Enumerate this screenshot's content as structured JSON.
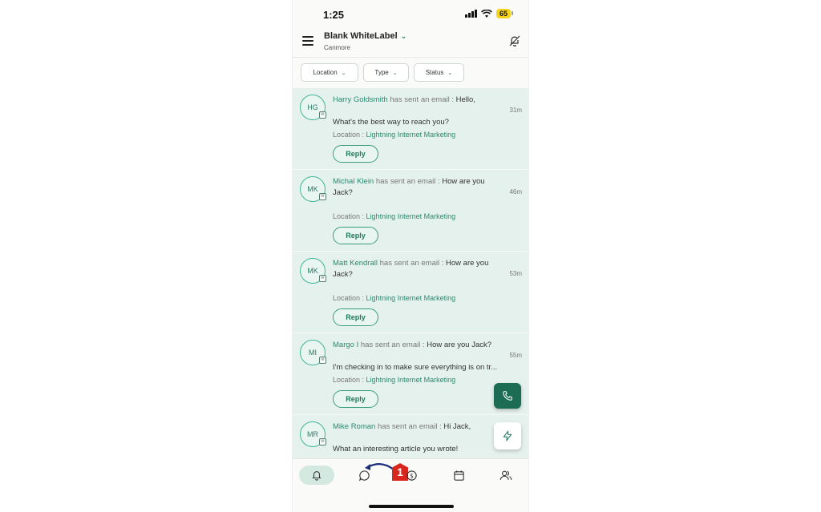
{
  "status_bar": {
    "time": "1:25",
    "battery": "65"
  },
  "header": {
    "title": "Blank WhiteLabel",
    "subtitle": "Canmore"
  },
  "filters": [
    "Location",
    "Type",
    "Status"
  ],
  "conversations": [
    {
      "initials": "HG",
      "name": "Harry Goldsmith",
      "action": "has sent an email :",
      "line1": "Hello,",
      "line2": "What's the best way to reach you?",
      "time": "31m",
      "location_label": "Location :",
      "location": "Lightning Internet Marketing",
      "reply": "Reply"
    },
    {
      "initials": "MK",
      "name": "Michal Klein",
      "action": "has sent an email :",
      "line1": "How are you",
      "line2": "Jack?",
      "time": "46m",
      "location_label": "Location :",
      "location": "Lightning Internet Marketing",
      "reply": "Reply"
    },
    {
      "initials": "MK",
      "name": "Matt Kendrall",
      "action": "has sent an email :",
      "line1": "How are you",
      "line2": "Jack?",
      "time": "53m",
      "location_label": "Location :",
      "location": "Lightning Internet Marketing",
      "reply": "Reply"
    },
    {
      "initials": "MI",
      "name": "Margo I",
      "action": "has sent an email :",
      "line1": "How are you Jack?",
      "line2": "I'm checking in to make sure everything is on tr...",
      "time": "55m",
      "location_label": "Location :",
      "location": "Lightning Internet Marketing",
      "reply": "Reply"
    },
    {
      "initials": "MR",
      "name": "Mike Roman",
      "action": "has sent an email :",
      "line1": "Hi Jack,",
      "line2": "What an interesting article you wrote!",
      "time": "",
      "location_label": "",
      "location": "",
      "reply": ""
    }
  ],
  "bottom_nav": {
    "items": [
      "notifications-icon",
      "conversations-icon",
      "payments-icon",
      "calendar-icon",
      "contacts-icon"
    ],
    "badge": "1"
  },
  "colors": {
    "accent": "#1f7a5c",
    "list_bg": "#e5f1ed",
    "fab": "#1c6b53",
    "badge": "#d9261c"
  }
}
